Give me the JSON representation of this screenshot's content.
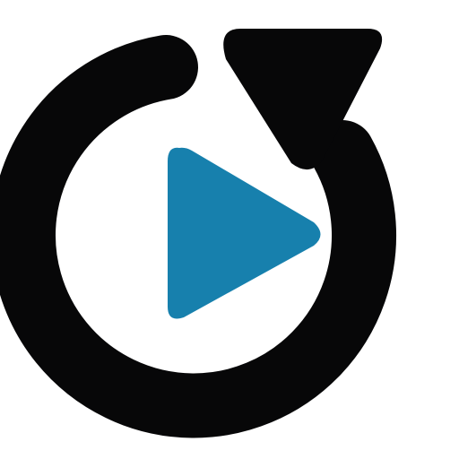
{
  "icon": {
    "name": "replay-icon",
    "parts": [
      "circular-arrow",
      "play-triangle"
    ]
  },
  "colors": {
    "background": "#ffffff",
    "arrow": "#070708",
    "play": "#1780ad"
  }
}
